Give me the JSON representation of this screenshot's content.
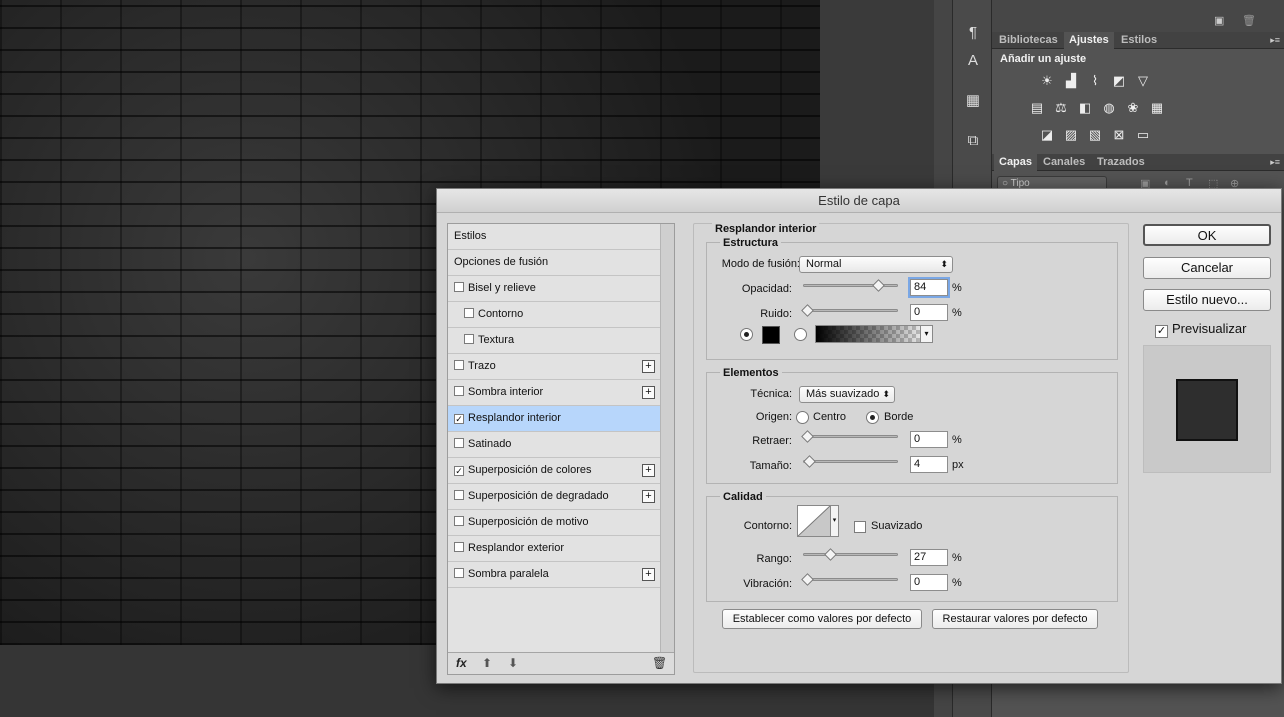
{
  "right_panel": {
    "tabs_top": [
      "Bibliotecas",
      "Ajustes",
      "Estilos"
    ],
    "active_top": "Ajustes",
    "adjust_title": "Añadir un ajuste",
    "tabs_bottom": [
      "Capas",
      "Canales",
      "Trazados"
    ],
    "active_bottom": "Capas",
    "layer_filter": "Tipo"
  },
  "dialog": {
    "title": "Estilo de capa",
    "styles_list": [
      {
        "label": "Estilos",
        "checkbox": false,
        "checked": false,
        "plus": false,
        "indent": 0,
        "selected": false
      },
      {
        "label": "Opciones de fusión",
        "checkbox": false,
        "checked": false,
        "plus": false,
        "indent": 0,
        "selected": false
      },
      {
        "label": "Bisel y relieve",
        "checkbox": true,
        "checked": false,
        "plus": false,
        "indent": 0,
        "selected": false
      },
      {
        "label": "Contorno",
        "checkbox": true,
        "checked": false,
        "plus": false,
        "indent": 1,
        "selected": false
      },
      {
        "label": "Textura",
        "checkbox": true,
        "checked": false,
        "plus": false,
        "indent": 1,
        "selected": false
      },
      {
        "label": "Trazo",
        "checkbox": true,
        "checked": false,
        "plus": true,
        "indent": 0,
        "selected": false
      },
      {
        "label": "Sombra interior",
        "checkbox": true,
        "checked": false,
        "plus": true,
        "indent": 0,
        "selected": false
      },
      {
        "label": "Resplandor interior",
        "checkbox": true,
        "checked": true,
        "plus": false,
        "indent": 0,
        "selected": true
      },
      {
        "label": "Satinado",
        "checkbox": true,
        "checked": false,
        "plus": false,
        "indent": 0,
        "selected": false
      },
      {
        "label": "Superposición de colores",
        "checkbox": true,
        "checked": true,
        "plus": true,
        "indent": 0,
        "selected": false
      },
      {
        "label": "Superposición de degradado",
        "checkbox": true,
        "checked": false,
        "plus": true,
        "indent": 0,
        "selected": false
      },
      {
        "label": "Superposición de motivo",
        "checkbox": true,
        "checked": false,
        "plus": false,
        "indent": 0,
        "selected": false
      },
      {
        "label": "Resplandor exterior",
        "checkbox": true,
        "checked": false,
        "plus": false,
        "indent": 0,
        "selected": false
      },
      {
        "label": "Sombra paralela",
        "checkbox": true,
        "checked": false,
        "plus": true,
        "indent": 0,
        "selected": false
      }
    ],
    "fx_label": "fx",
    "panel_title": "Resplandor interior",
    "estructura": {
      "title": "Estructura",
      "blend_label": "Modo de fusión:",
      "blend_value": "Normal",
      "opacity_label": "Opacidad:",
      "opacity_value": "84",
      "opacity_pct": 84,
      "noise_label": "Ruido:",
      "noise_value": "0",
      "noise_pct": 0,
      "unit": "%",
      "color": "#000000"
    },
    "elementos": {
      "title": "Elementos",
      "technique_label": "Técnica:",
      "technique_value": "Más suavizado",
      "origin_label": "Origen:",
      "origin_center": "Centro",
      "origin_edge": "Borde",
      "choke_label": "Retraer:",
      "choke_value": "0",
      "choke_pct": 0,
      "size_label": "Tamaño:",
      "size_value": "4",
      "size_fraction": 0.02,
      "size_unit": "px",
      "unit": "%"
    },
    "calidad": {
      "title": "Calidad",
      "contour_label": "Contorno:",
      "antialias_label": "Suavizado",
      "range_label": "Rango:",
      "range_value": "27",
      "range_pct": 27,
      "jitter_label": "Vibración:",
      "jitter_value": "0",
      "jitter_pct": 0,
      "unit": "%"
    },
    "default_btn": "Establecer como valores por defecto",
    "reset_btn": "Restaurar valores por defecto",
    "ok": "OK",
    "cancel": "Cancelar",
    "new_style": "Estilo nuevo...",
    "preview_label": "Previsualizar",
    "preview_checked": true
  }
}
